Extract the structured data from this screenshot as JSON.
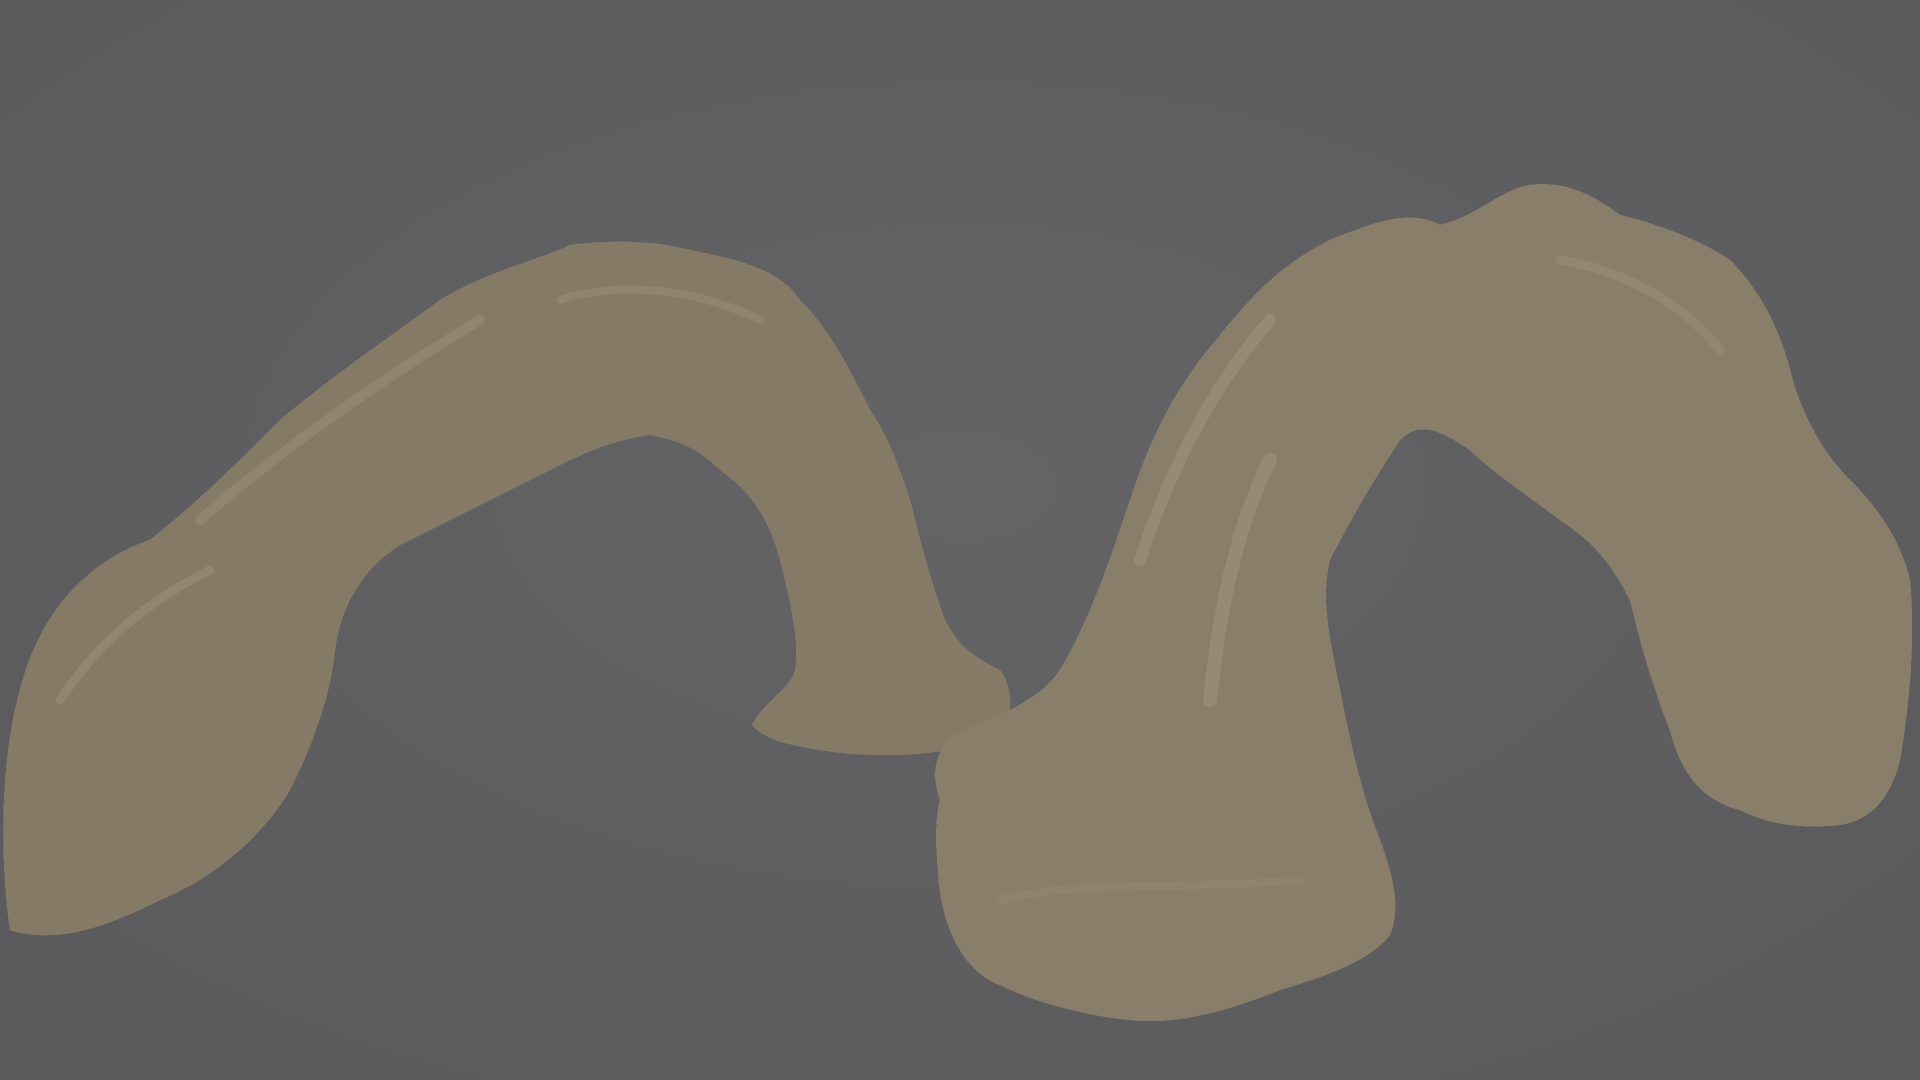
{
  "scene": {
    "background_color": "#5f5f61",
    "objects": [
      {
        "name": "mossy-rock-arch-left",
        "rock_color": "#8a7f6c",
        "moss_color": "#4f6e2a"
      },
      {
        "name": "mossy-rock-arch-right",
        "rock_color": "#8c826e",
        "moss_color": "#52752c"
      }
    ]
  }
}
